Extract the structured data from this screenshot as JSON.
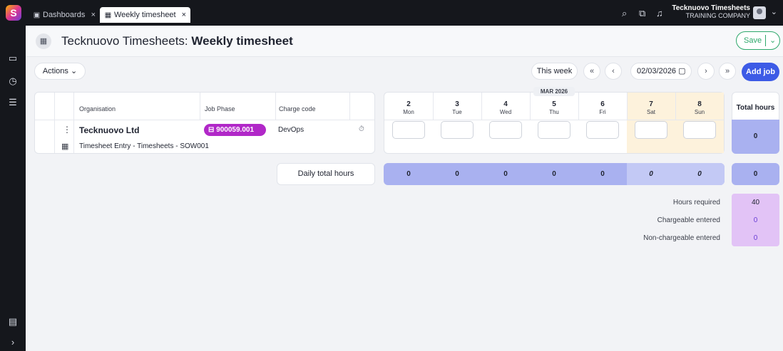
{
  "tabs": [
    {
      "icon": "dashboard-icon",
      "label": "Dashboards"
    },
    {
      "icon": "calendar-icon",
      "label": "Weekly timesheet"
    }
  ],
  "tab_close": "×",
  "company": {
    "name": "Tecknuovo Timesheets",
    "subtitle": "TRAINING COMPANY"
  },
  "header": {
    "title_prefix": "Tecknuovo Timesheets:",
    "title_main": " Weekly timesheet",
    "save_label": "Save"
  },
  "toolbar": {
    "actions_label": "Actions",
    "this_week_label": "This week",
    "date_value": "02/03/2026",
    "add_job_label": "Add job"
  },
  "table": {
    "headers": {
      "organisation": "Organisation",
      "job_phase": "Job Phase",
      "charge_code": "Charge code"
    },
    "row": {
      "organisation": "Tecknuovo Ltd",
      "job_phase": "900059.001",
      "charge_code": "DevOps",
      "entry": "Timesheet Entry - Timesheets - SOW001"
    }
  },
  "month_label": "MAR 2026",
  "days": [
    {
      "num": "2",
      "name": "Mon",
      "daily": "0"
    },
    {
      "num": "3",
      "name": "Tue",
      "daily": "0"
    },
    {
      "num": "4",
      "name": "Wed",
      "daily": "0"
    },
    {
      "num": "5",
      "name": "Thu",
      "daily": "0"
    },
    {
      "num": "6",
      "name": "Fri",
      "daily": "0"
    },
    {
      "num": "7",
      "name": "Sat",
      "daily": "0"
    },
    {
      "num": "8",
      "name": "Sun",
      "daily": "0"
    }
  ],
  "totals": {
    "label": "Total hours",
    "row_total": "0",
    "daily_label": "Daily total hours",
    "daily_total": "0"
  },
  "summary": [
    {
      "label": "Hours required",
      "value": "40"
    },
    {
      "label": "Chargeable entered",
      "value": "0"
    },
    {
      "label": "Non-chargeable entered",
      "value": "0"
    }
  ],
  "colors": {
    "accent": "#3d5be6",
    "save": "#2ea86b",
    "job_badge": "#b128c8",
    "weekend": "#fdf2dc",
    "hours_bar": "#a9b1f0",
    "summary": "#e2c3f6"
  }
}
